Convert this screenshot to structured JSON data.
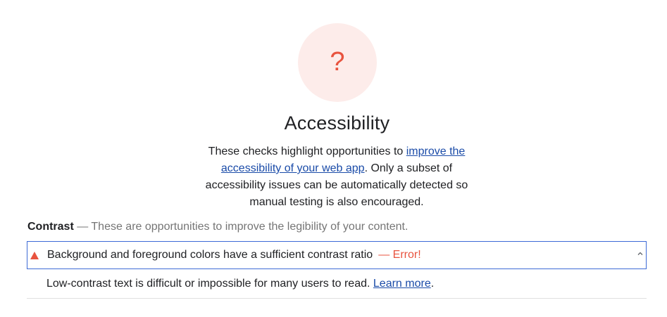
{
  "score": {
    "symbol": "?",
    "color": "#e8533f",
    "background": "#fdecea"
  },
  "category": {
    "title": "Accessibility",
    "description_before": "These checks highlight opportunities to ",
    "description_link": "improve the accessibility of your web app",
    "description_after": ". Only a subset of accessibility issues can be automatically detected so manual testing is also encouraged."
  },
  "group": {
    "title": "Contrast",
    "separator": " — ",
    "description": "These are opportunities to improve the legibility of your content."
  },
  "audit": {
    "status_icon": "fail-triangle-icon",
    "title": "Background and foreground colors have a sufficient contrast ratio",
    "error": "— Error!",
    "expand_icon": "chevron-up-icon",
    "details_text": "Low-contrast text is difficult or impossible for many users to read. ",
    "details_link": "Learn more",
    "details_end": "."
  },
  "colors": {
    "link": "#1a4ba8",
    "error": "#e8533f",
    "focus_border": "#3d6ad6"
  }
}
